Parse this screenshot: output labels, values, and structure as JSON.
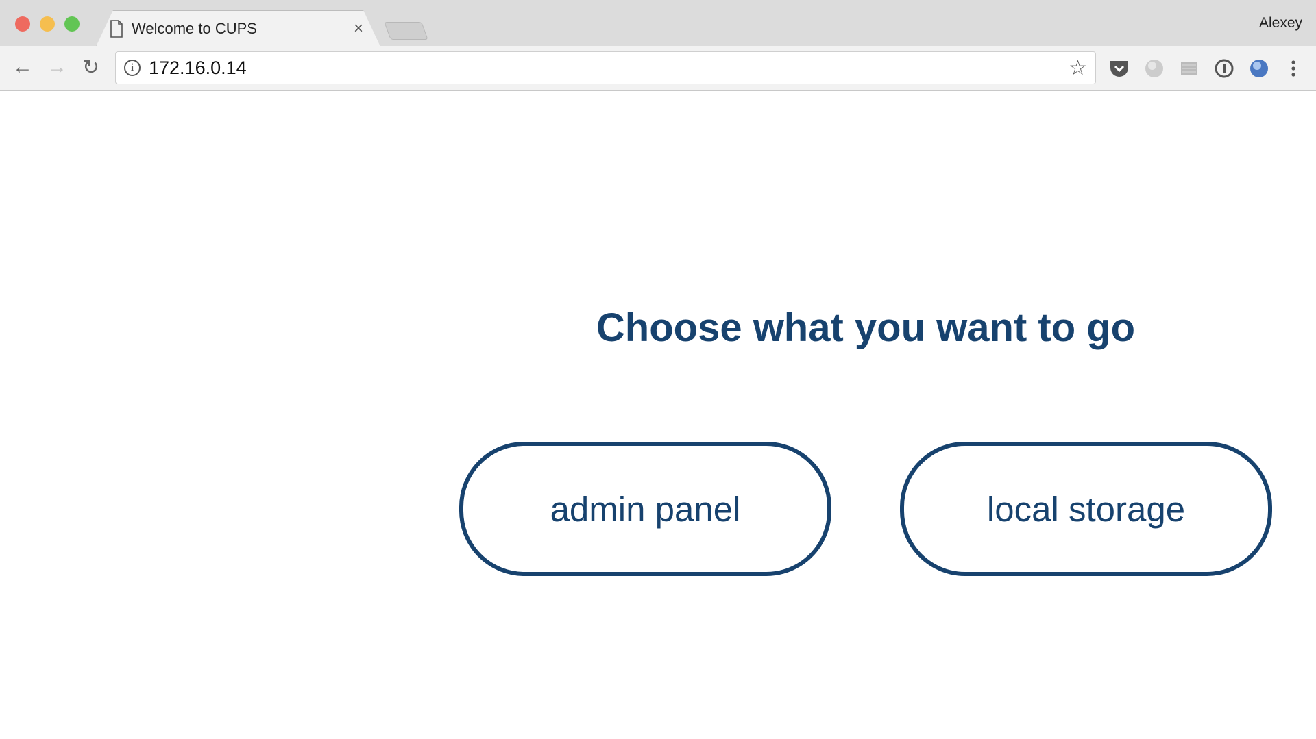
{
  "browser": {
    "tab_title": "Welcome to CUPS",
    "tab_close": "×",
    "profile_name": "Alexey",
    "url": "172.16.0.14",
    "extensions": [
      "pocket-icon",
      "globe-grey-icon",
      "cookie-inspector-icon",
      "1password-icon",
      "globe-blue-icon"
    ]
  },
  "page": {
    "heading": "Choose what you want to go",
    "buttons": {
      "admin": "admin panel",
      "storage": "local storage"
    },
    "accent_color": "#17426e"
  }
}
